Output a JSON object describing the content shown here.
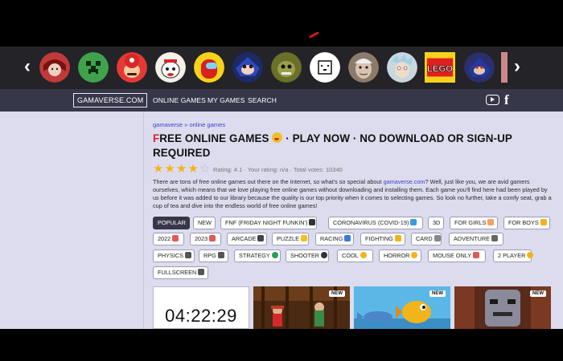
{
  "header": {
    "carousel_prev": "‹",
    "carousel_next": "›",
    "characters": [
      {
        "name": "fnf-girlfriend",
        "bg": "#c13a3a"
      },
      {
        "name": "creeper",
        "bg": "#3fa34d"
      },
      {
        "name": "mario",
        "bg": "#e53935"
      },
      {
        "name": "cuphead",
        "bg": "#f4f1e8"
      },
      {
        "name": "among-us-crewmate",
        "bg": "#f7d21a"
      },
      {
        "name": "sonic-exe",
        "bg": "#1c2a66"
      },
      {
        "name": "fnaf-springtrap",
        "bg": "#6b6f2a"
      },
      {
        "name": "undertale-dog",
        "bg": "#ffffff"
      },
      {
        "name": "granny",
        "bg": "#8b7b6b"
      },
      {
        "name": "rick",
        "bg": "#c9d7df"
      },
      {
        "name": "lego",
        "bg": "#f6d21a"
      },
      {
        "name": "sonic-dark",
        "bg": "#2b2f6d"
      }
    ]
  },
  "nav": {
    "logo": "GAMAVERSE.COM",
    "links": [
      "ONLINE GAMES",
      "MY GAMES",
      "SEARCH"
    ]
  },
  "breadcrumb": {
    "home": "gamaverse",
    "separator": " » ",
    "current": "online games"
  },
  "title": {
    "first_letter": "F",
    "part1": "REE ONLINE GAMES",
    "part2": " · PLAY NOW · NO DOWNLOAD OR SIGN-UP REQUIRED"
  },
  "rating": {
    "value": 4.1,
    "stars_filled": 4,
    "stars_total": 5,
    "text": "Rating: 4.1 · Your rating: n/a · Total votes: 10340"
  },
  "description": {
    "part1": "There are tons of free online games out there on the Internet, so what's so special about ",
    "link": "gamaverse.com",
    "part2": "? Well, just like you, we are avid gamers ourselves, which means that we love playing free online games without downloading and installing them. Each game you'll find here had been played by us before it was added to our library because the quality is our top priority when it comes to selecting games. So look no further, take a comfy seat, grab a cup of tea and dive into the endless world of free online games!"
  },
  "tags": [
    {
      "label": "POPULAR",
      "icon_color": ""
    },
    {
      "label": "NEW",
      "icon_color": ""
    },
    {
      "label": "FNF (FRIDAY NIGHT FUNKIN')",
      "icon_color": "#333333"
    },
    {
      "label": "CORONAVIRUS (COVID-19)",
      "icon_color": "#3a9be0"
    },
    {
      "label": "3D",
      "icon_color": ""
    },
    {
      "label": "FOR GIRLS",
      "icon_color": "#f5a35c"
    },
    {
      "label": "FOR BOYS",
      "icon_color": "#f2b41b"
    },
    {
      "label": "2022",
      "icon_color": "#e05a5a"
    },
    {
      "label": "2023",
      "icon_color": "#e05a5a"
    },
    {
      "label": "ARCADE",
      "icon_color": "#444444"
    },
    {
      "label": "PUZZLE",
      "icon_color": "#f2c21b"
    },
    {
      "label": "RACING",
      "icon_color": "#3a7be0"
    },
    {
      "label": "FIGHTING",
      "icon_color": "#f2b41b"
    },
    {
      "label": "CARD",
      "icon_color": "#888888"
    },
    {
      "label": "ADVENTURE",
      "icon_color": "#666666"
    },
    {
      "label": "PHYSICS",
      "icon_color": "#555555"
    },
    {
      "label": "RPG",
      "icon_color": "#555555"
    },
    {
      "label": "STRATEGY",
      "icon_color": "#2a9d5c"
    },
    {
      "label": "SHOOTER",
      "icon_color": "#333333"
    },
    {
      "label": "COOL",
      "icon_color": "#f2b41b"
    },
    {
      "label": "HORROR",
      "icon_color": "#f2b41b"
    },
    {
      "label": "MOUSE ONLY",
      "icon_color": "#e05a5a"
    },
    {
      "label": "2 PLAYER",
      "icon_color": "#f2b41b"
    },
    {
      "label": "FULLSCREEN",
      "icon_color": "#555555"
    }
  ],
  "tiles": {
    "timer": "04:22:29",
    "new_label": "NEW"
  },
  "colors": {
    "accent_blue": "#3a45c8",
    "brand_red": "#e21b1b",
    "nav_bg": "#37374a",
    "page_bg": "#dcdcee",
    "star": "#f2b41b"
  }
}
